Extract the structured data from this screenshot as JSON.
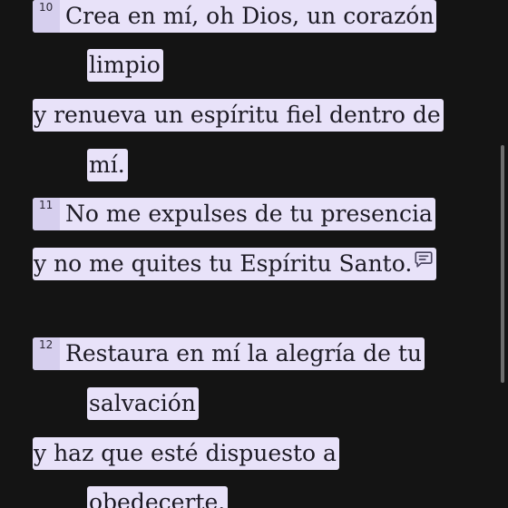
{
  "verses": [
    {
      "number": "10",
      "lines": [
        "Crea en mí, oh Dios, un corazón",
        "limpio",
        "y renueva un espíritu fiel dentro de",
        "mí."
      ]
    },
    {
      "number": "11",
      "lines": [
        "No me expulses de tu presencia",
        "y no me quites tu Espíritu Santo."
      ],
      "note_icon": "note-comment-icon"
    },
    {
      "number": "12",
      "lines": [
        "Restaura en mí la alegría de tu",
        "salvación",
        "y haz que esté dispuesto a",
        "obedecerte."
      ]
    }
  ],
  "colors": {
    "background": "#141414",
    "highlight": "#e8e2f9",
    "verse_number_chip": "#d6cfee",
    "text": "#1c1a24",
    "scrollbar": "#6d6d6d"
  }
}
